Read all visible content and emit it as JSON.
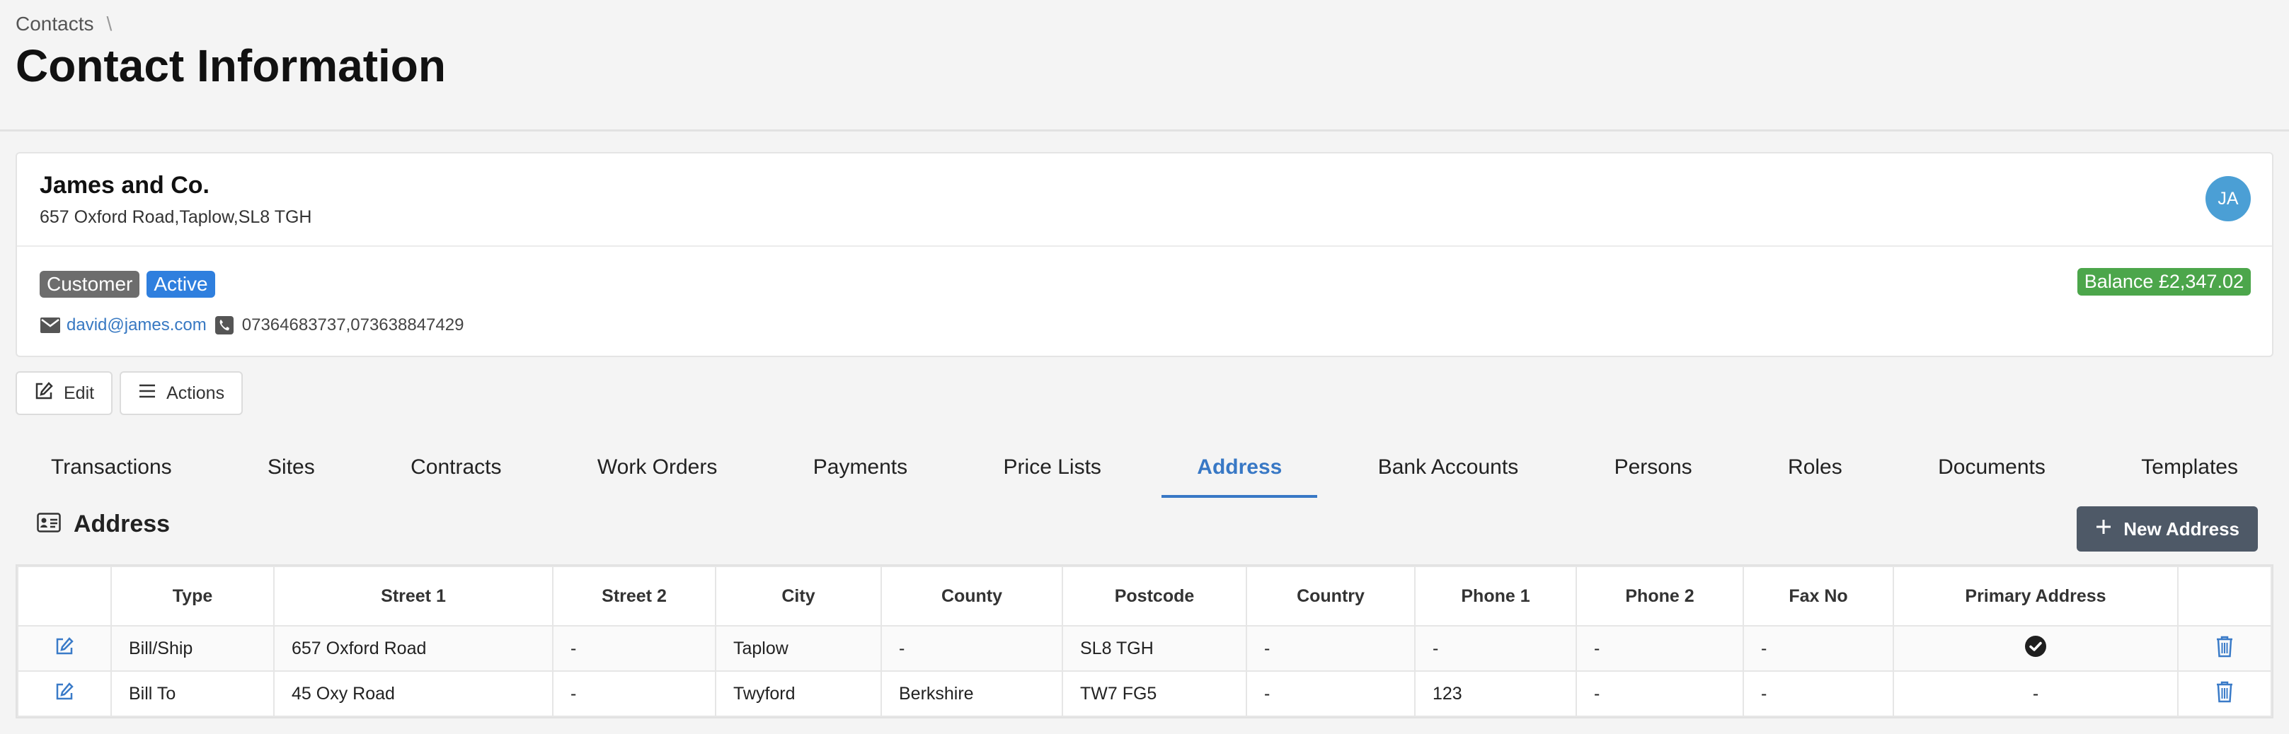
{
  "breadcrumb": {
    "root": "Contacts",
    "separator": "\\"
  },
  "page": {
    "title": "Contact Information"
  },
  "contact": {
    "name": "James and Co.",
    "address": "657 Oxford Road,Taplow,SL8 TGH",
    "avatar_initials": "JA",
    "badges": {
      "type": "Customer",
      "status": "Active"
    },
    "balance": "Balance £2,347.02",
    "email": "david@james.com",
    "phones": "07364683737,073638847429"
  },
  "toolbar": {
    "edit_label": "Edit",
    "actions_label": "Actions"
  },
  "tabs": [
    {
      "label": "Transactions",
      "active": false
    },
    {
      "label": "Sites",
      "active": false
    },
    {
      "label": "Contracts",
      "active": false
    },
    {
      "label": "Work Orders",
      "active": false
    },
    {
      "label": "Payments",
      "active": false
    },
    {
      "label": "Price Lists",
      "active": false
    },
    {
      "label": "Address",
      "active": true
    },
    {
      "label": "Bank Accounts",
      "active": false
    },
    {
      "label": "Persons",
      "active": false
    },
    {
      "label": "Roles",
      "active": false
    },
    {
      "label": "Documents",
      "active": false
    },
    {
      "label": "Templates",
      "active": false
    }
  ],
  "address_section": {
    "title": "Address",
    "new_button_label": "New Address",
    "columns": [
      "",
      "Type",
      "Street 1",
      "Street 2",
      "City",
      "County",
      "Postcode",
      "Country",
      "Phone 1",
      "Phone 2",
      "Fax No",
      "Primary Address",
      ""
    ],
    "rows": [
      {
        "type": "Bill/Ship",
        "street1": "657 Oxford Road",
        "street2": "-",
        "city": "Taplow",
        "county": "-",
        "postcode": "SL8 TGH",
        "country": "-",
        "phone1": "-",
        "phone2": "-",
        "fax": "-",
        "primary": true,
        "primary_text": ""
      },
      {
        "type": "Bill To",
        "street1": "45 Oxy Road",
        "street2": "-",
        "city": "Twyford",
        "county": "Berkshire",
        "postcode": "TW7 FG5",
        "country": "-",
        "phone1": "123",
        "phone2": "-",
        "fax": "-",
        "primary": false,
        "primary_text": "-"
      }
    ]
  },
  "colors": {
    "accent": "#3878c5",
    "badge_customer": "#6d6d6d",
    "badge_active": "#2f7fde",
    "balance": "#4ca64b",
    "avatar": "#4b9fd5",
    "delete": "#3a7bc8",
    "new_button": "#4e5967"
  },
  "icons": {
    "edit": "pencil-square-icon",
    "actions": "list-lines-icon",
    "email": "envelope-icon",
    "phone": "phone-icon",
    "section": "id-card-icon",
    "add": "plus-icon",
    "row_edit": "pencil-square-icon",
    "row_delete": "trash-icon",
    "primary": "check-circle-icon"
  }
}
